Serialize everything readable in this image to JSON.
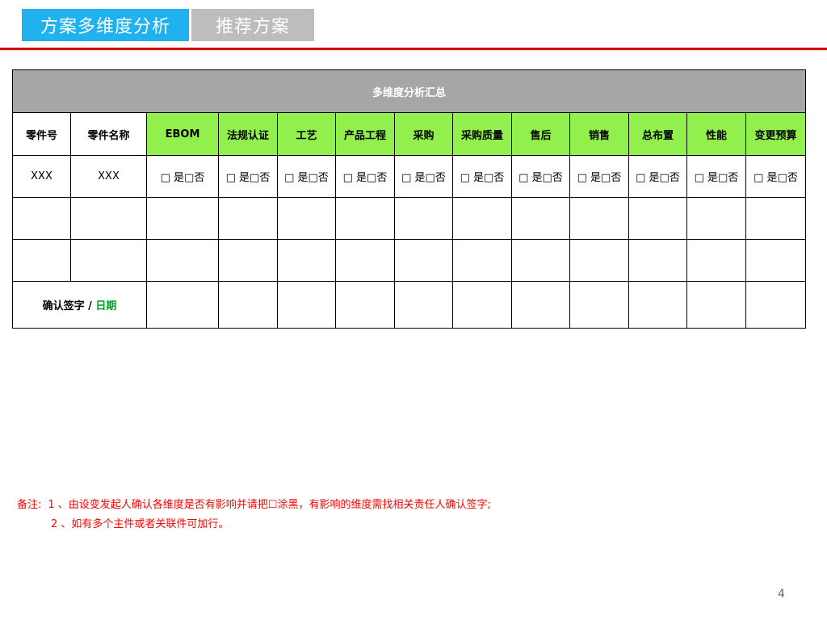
{
  "tabs": {
    "active": "方案多维度分析",
    "inactive": "推荐方案"
  },
  "table": {
    "title": "多维度分析汇总",
    "headers": {
      "part_no": "零件号",
      "part_name": "零件名称",
      "dimensions": [
        "EBOM",
        "法规认证",
        "工艺",
        "产品工程",
        "采购",
        "采购质量",
        "售后",
        "销售",
        "总布置",
        "性能",
        "变更预算"
      ]
    },
    "first_row": {
      "part_no": "XXX",
      "part_name": "XXX",
      "option": "□ 是□否"
    },
    "sign": {
      "label": "确认签字 / ",
      "date": "日期"
    }
  },
  "notes": {
    "label": "备注:",
    "line1": "1 、由设变发起人确认各维度是否有影响并请把☐涂黑，有影响的维度需找相关责任人确认签字;",
    "line2": "2 、如有多个主件或者关联件可加行。"
  },
  "page_number": "4",
  "colors": {
    "tab_active": "#1fb2ef",
    "tab_inactive": "#bdbdbd",
    "header_green": "#92f04c",
    "title_gray": "#a6a6a6",
    "accent_red": "#d40000",
    "date_green": "#00a02a"
  }
}
